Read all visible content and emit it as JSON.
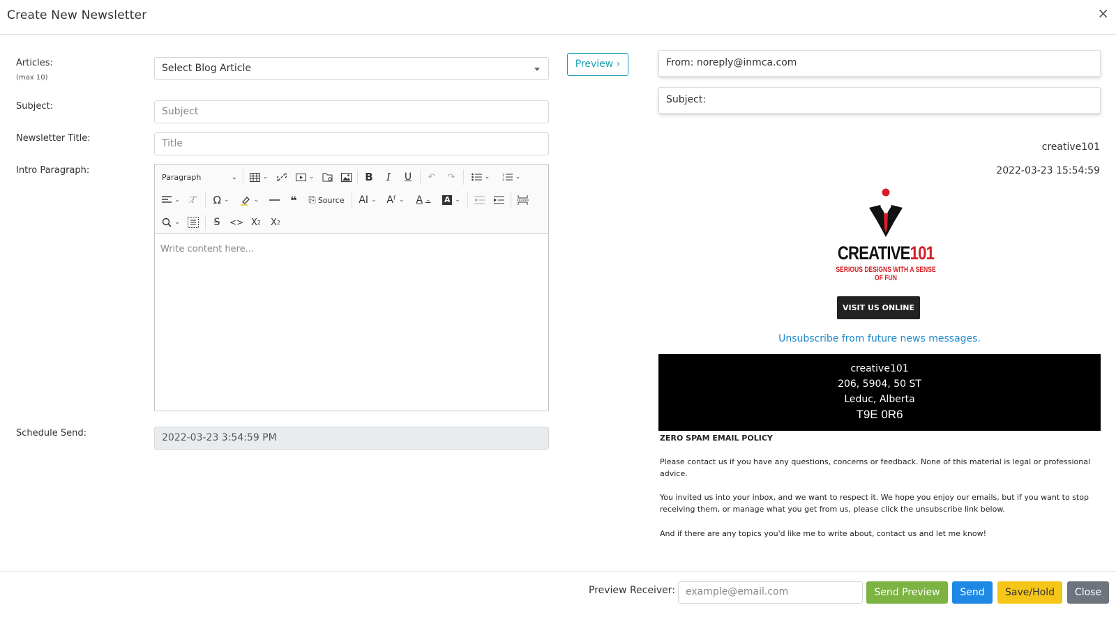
{
  "modal": {
    "title": "Create New Newsletter",
    "close_icon": "×"
  },
  "form": {
    "articles_label": "Articles:",
    "articles_sublabel": "(max 10)",
    "articles_select": "Select Blog Article",
    "preview_button": "Preview ›",
    "subject_label": "Subject:",
    "subject_placeholder": "Subject",
    "title_label": "Newsletter Title:",
    "title_placeholder": "Title",
    "intro_label": "Intro Paragraph:",
    "schedule_label": "Schedule Send:",
    "schedule_value": "2022-03-23 3:54:59 PM"
  },
  "editor": {
    "paragraph_select": "Paragraph",
    "source_label": "Source",
    "placeholder": "Write content here...",
    "toolbar_icons": [
      "table-icon",
      "link-icon",
      "media-icon",
      "file-icon",
      "image-icon",
      "bold-icon",
      "italic-icon",
      "underline-icon",
      "undo-icon",
      "redo-icon",
      "bullet-list-icon",
      "numbered-list-icon",
      "align-icon",
      "clear-format-icon",
      "special-char-icon",
      "highlight-icon",
      "horizontal-line-icon",
      "blockquote-icon",
      "source-icon",
      "font-size-icon",
      "font-family-icon",
      "font-color-icon",
      "bg-color-icon",
      "outdent-icon",
      "indent-icon",
      "page-break-icon",
      "find-replace-icon",
      "select-all-icon",
      "strikethrough-icon",
      "code-icon",
      "subscript-icon",
      "superscript-icon"
    ]
  },
  "preview": {
    "from": "From: noreply@inmca.com",
    "subject": "Subject:",
    "sender": "creative101",
    "datetime": "2022-03-23 15:54:59",
    "logo_word_black": "CREATIVE",
    "logo_word_red": "101",
    "logo_tagline": "SERIOUS DESIGNS WITH A SENSE OF FUN",
    "visit_button": "VISIT US ONLINE",
    "unsubscribe": "Unsubscribe from future news messages.",
    "address": [
      "creative101",
      "206, 5904, 50 ST",
      "Leduc, Alberta",
      "T9E 0R6"
    ],
    "policy_title": "ZERO SPAM EMAIL POLICY",
    "policy_p1": "Please contact us if you have any questions, concerns or feedback. None of this material is legal or professional advice.",
    "policy_p2": "You invited us into your inbox, and we want to respect it. We hope you enjoy our emails, but if you want to stop receiving them, or manage what you get from us, please click the unsubscribe link below.",
    "policy_p3": "And if there are any topics you'd like me to write about, contact us and let me know!"
  },
  "footer": {
    "receiver_label": "Preview Receiver:",
    "receiver_placeholder": "example@email.com",
    "send_preview": "Send Preview",
    "send": "Send",
    "save_hold": "Save/Hold",
    "close": "Close"
  },
  "colors": {
    "green": "#7cb342",
    "blue": "#1e88e5",
    "yellow": "#f5c518",
    "gray": "#6c757d",
    "teal": "#17a2b8",
    "link": "#1e88c8",
    "logo_red": "#d41f26"
  }
}
